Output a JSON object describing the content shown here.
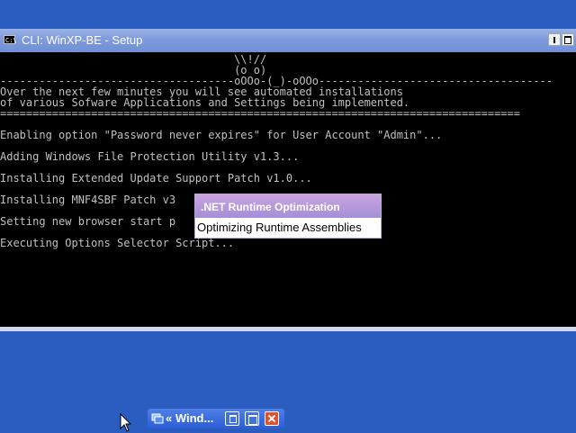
{
  "window": {
    "title": "CLI: WinXP-BE - Setup",
    "icon": "command-prompt-icon",
    "icon_text": "C:\\"
  },
  "console": {
    "lines": [
      "                                    \\\\!//",
      "                                    (o o)",
      "------------------------------------oOOo-(_)-oOOo------------------------------------",
      "Over the next few minutes you will see automated installations",
      "of various Sofware Applications and Settings being implemented.",
      "================================================================================",
      "",
      "Enabling option \"Password never expires\" for User Account \"Admin\"...",
      "",
      "Adding Windows File Protection Utility v1.3...",
      "",
      "Installing Extended Update Support Patch v1.0...",
      "",
      "Installing MNF4SBF Patch v3",
      "",
      "Setting new browser start p",
      "",
      "Executing Options Selector Script..."
    ]
  },
  "balloon": {
    "title": ".NET Runtime Optimization",
    "message": "Optimizing Runtime Assemblies"
  },
  "taskbar": {
    "label": "« Wind...",
    "icon": "windows-group-icon"
  },
  "colors": {
    "desktop": "#2b5dc0",
    "console_text": "#c0c0c0",
    "balloon_title": "#b49adb",
    "close": "#e1502c"
  }
}
